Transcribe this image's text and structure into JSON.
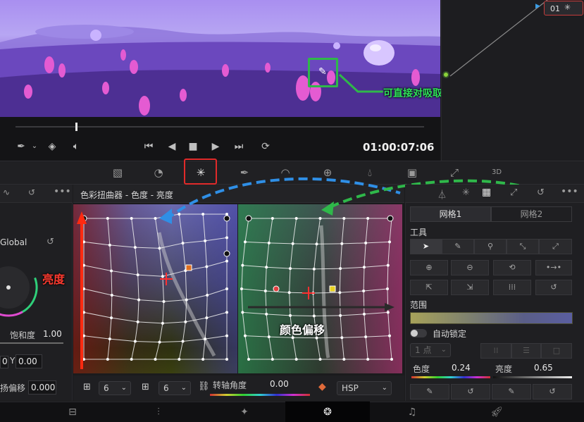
{
  "viewer": {
    "timecode": "01:00:07:06",
    "transport_icons": [
      "skip-back-icon",
      "play-reverse-icon",
      "stop-icon",
      "play-icon",
      "skip-forward-icon",
      "loop-icon"
    ]
  },
  "node": {
    "label": "01"
  },
  "annotations": {
    "eyedropper_tip": "可直接对吸取颜色拖动调色",
    "luma": "亮度",
    "hue_shift": "颜色偏移"
  },
  "left_panel": {
    "mode_label": "Global",
    "saturation_label": "饱和度",
    "saturation_value": "1.00",
    "y_label": "Y",
    "y_value": "0.00",
    "x_value": "0",
    "offset_label": "扬偏移",
    "offset_value": "0.000"
  },
  "warper": {
    "title": "色彩扭曲器 - 色度 - 亮度",
    "grid_cols_value": "6",
    "grid_rows_value": "6",
    "rotation_label": "转轴角度",
    "rotation_value": "0.00",
    "colorspace_value": "HSP"
  },
  "right_panel": {
    "tabs": [
      "网格1",
      "网格2"
    ],
    "tools_label": "工具",
    "range_label": "范围",
    "auto_lock_label": "自动锁定",
    "points_select": "1 点",
    "hue_label": "色度",
    "hue_value": "0.24",
    "luma_label": "亮度",
    "luma_value": "0.65"
  },
  "colors": {
    "accent_red": "#e12a2a",
    "annotation_green": "#2fb84a",
    "annotation_blue": "#2f8fe6",
    "annotation_red_text": "#ff3b30"
  }
}
